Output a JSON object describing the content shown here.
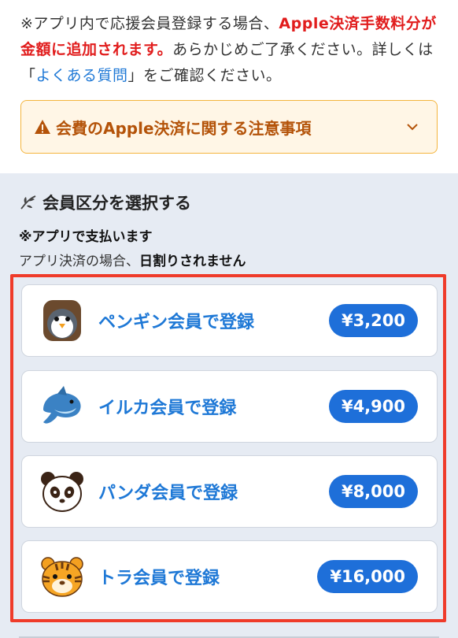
{
  "notice": {
    "part1": "※アプリ内で応援会員登録する場合、",
    "red": "Apple決済手数料分が金額に追加されます。",
    "part2": "あらかじめご了承ください。詳しくは「",
    "link": "よくある質問",
    "part3": "」をご確認ください。"
  },
  "warning": {
    "label": "会費のApple決済に関する注意事項"
  },
  "plans": {
    "title": "会員区分を選択する",
    "note_app": "※アプリで支払います",
    "note_pre": "アプリ決済の場合、",
    "note_bold": "日割りされません",
    "items": [
      {
        "label": "ペンギン会員で登録",
        "price": "¥3,200",
        "icon": "penguin-icon"
      },
      {
        "label": "イルカ会員で登録",
        "price": "¥4,900",
        "icon": "dolphin-icon"
      },
      {
        "label": "パンダ会員で登録",
        "price": "¥8,000",
        "icon": "panda-icon"
      },
      {
        "label": "トラ会員で登録",
        "price": "¥16,000",
        "icon": "tiger-icon"
      }
    ]
  },
  "colors": {
    "accent": "#1e78d6",
    "warning": "#f4b43c",
    "highlight": "#ef3b2a"
  }
}
